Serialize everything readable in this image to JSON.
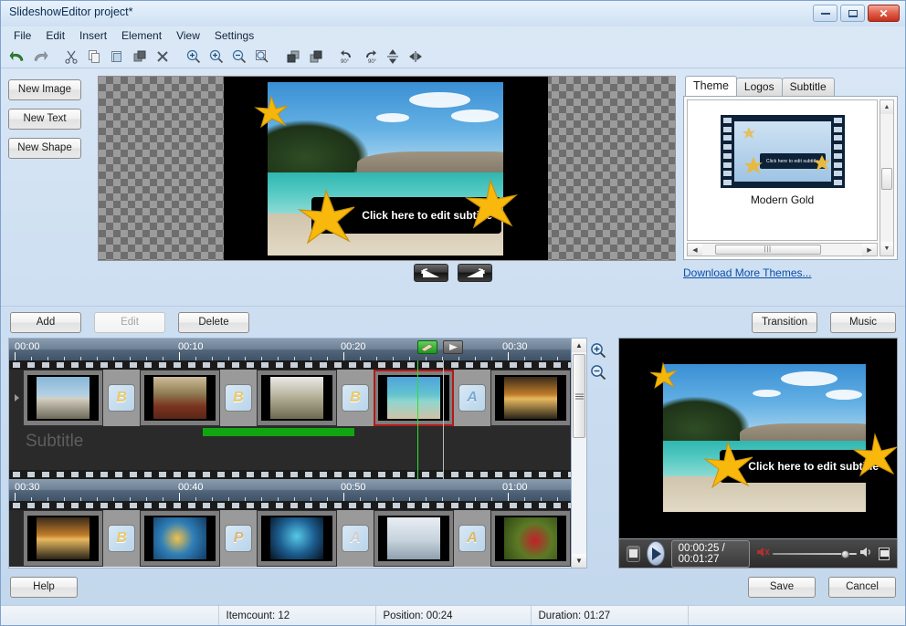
{
  "window": {
    "title": "SlideshowEditor project*",
    "controls": {
      "minimize": "minimize-button",
      "maximize": "maximize-button",
      "close": "✕"
    }
  },
  "menu": {
    "items": [
      "File",
      "Edit",
      "Insert",
      "Element",
      "View",
      "Settings"
    ]
  },
  "toolbar": {
    "icons": [
      "undo-icon",
      "redo-icon",
      "cut-icon",
      "copy-icon",
      "paste-icon",
      "duplicate-icon",
      "delete-icon",
      "zoom-in-icon",
      "zoom-actual-icon",
      "zoom-out-icon",
      "zoom-fit-icon",
      "bring-to-front-icon",
      "send-to-back-icon",
      "rotate-left-90-icon",
      "rotate-right-90-icon",
      "flip-vertical-icon",
      "flip-horizontal-icon"
    ]
  },
  "left_tools": {
    "buttons": [
      "New Image",
      "New Text",
      "New Shape"
    ]
  },
  "canvas": {
    "subtitle_text": "Click here to edit subtitle",
    "nav_prev": "previous-slide-button",
    "nav_next": "next-slide-button"
  },
  "theme_panel": {
    "tabs": [
      {
        "label": "Theme",
        "active": true
      },
      {
        "label": "Logos",
        "active": false
      },
      {
        "label": "Subtitle",
        "active": false
      }
    ],
    "selected_theme": "Modern Gold",
    "theme_preview_subtitle": "Click here to edit subtitle",
    "download_link": "Download More Themes..."
  },
  "clip_actions": {
    "add": "Add",
    "edit": "Edit",
    "delete": "Delete",
    "transition": "Transition",
    "music": "Music"
  },
  "timeline": {
    "row1_labels": [
      "00:00",
      "00:10",
      "00:20",
      "00:30"
    ],
    "row2_labels": [
      "00:30",
      "00:40",
      "00:50",
      "01:00"
    ],
    "subtitle_track_label": "Subtitle",
    "transition_badges_row1": [
      "B",
      "B",
      "B",
      "A"
    ],
    "transition_badges_row2": [
      "B",
      "P",
      "A",
      "A"
    ],
    "selected_clip_index": 3,
    "zoom_in": "zoom-in-button",
    "zoom_out": "zoom-out-button",
    "marker_edit": "edit-position-marker",
    "marker_play": "play-position-marker"
  },
  "player": {
    "stop": "stop-button",
    "play": "play-button",
    "time": "00:00:25 / 00:01:27",
    "mute": "mute-icon",
    "volume": "volume-slider",
    "fullscreen": "fullscreen-button",
    "subtitle_text": "Click here to edit subtitle"
  },
  "footer": {
    "help": "Help",
    "save": "Save",
    "cancel": "Cancel"
  },
  "status": {
    "itemcount": "Itemcount: 12",
    "position": "Position: 00:24",
    "duration": "Duration: 01:27"
  },
  "colors": {
    "accent": "#0b4fa8",
    "selection": "#b51919",
    "playhead": "#2fe02f",
    "subtitle_bar": "#12a512",
    "star": "#F5B60B"
  }
}
